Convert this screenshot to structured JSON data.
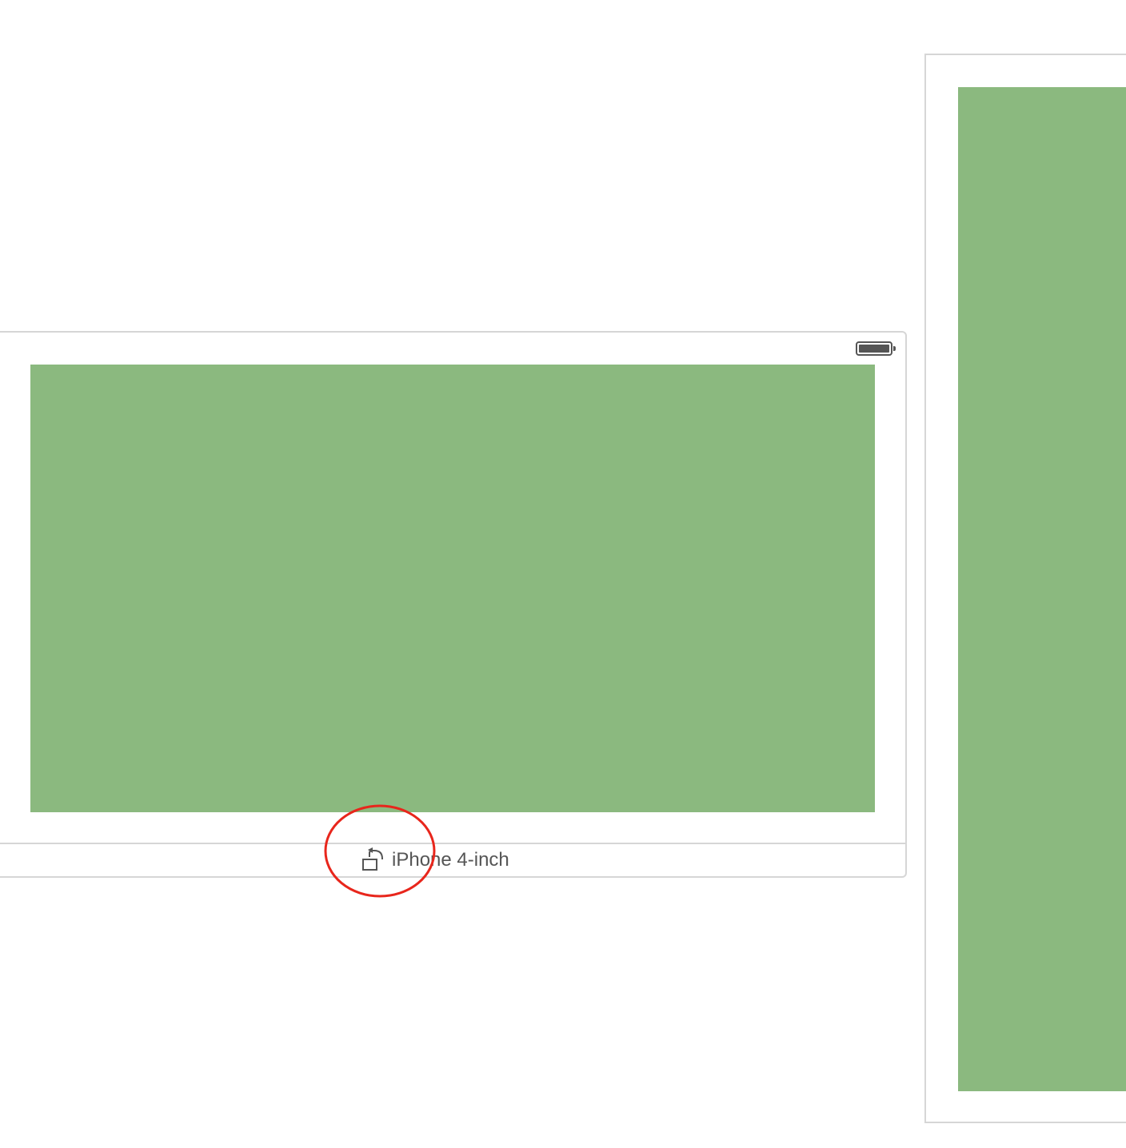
{
  "colors": {
    "view_background": "#8BB97F",
    "frame_border": "#D6D6D6",
    "annotation": "#E8261C",
    "label_text": "#555555"
  },
  "landscape_scene": {
    "device_label": "iPhone 4-inch",
    "rotate_icon": "rotate-orientation-icon",
    "battery_icon": "battery-full-icon"
  },
  "portrait_scene": {
    "visible": true
  },
  "annotation": {
    "shape": "circle",
    "target": "rotate-orientation-icon"
  }
}
